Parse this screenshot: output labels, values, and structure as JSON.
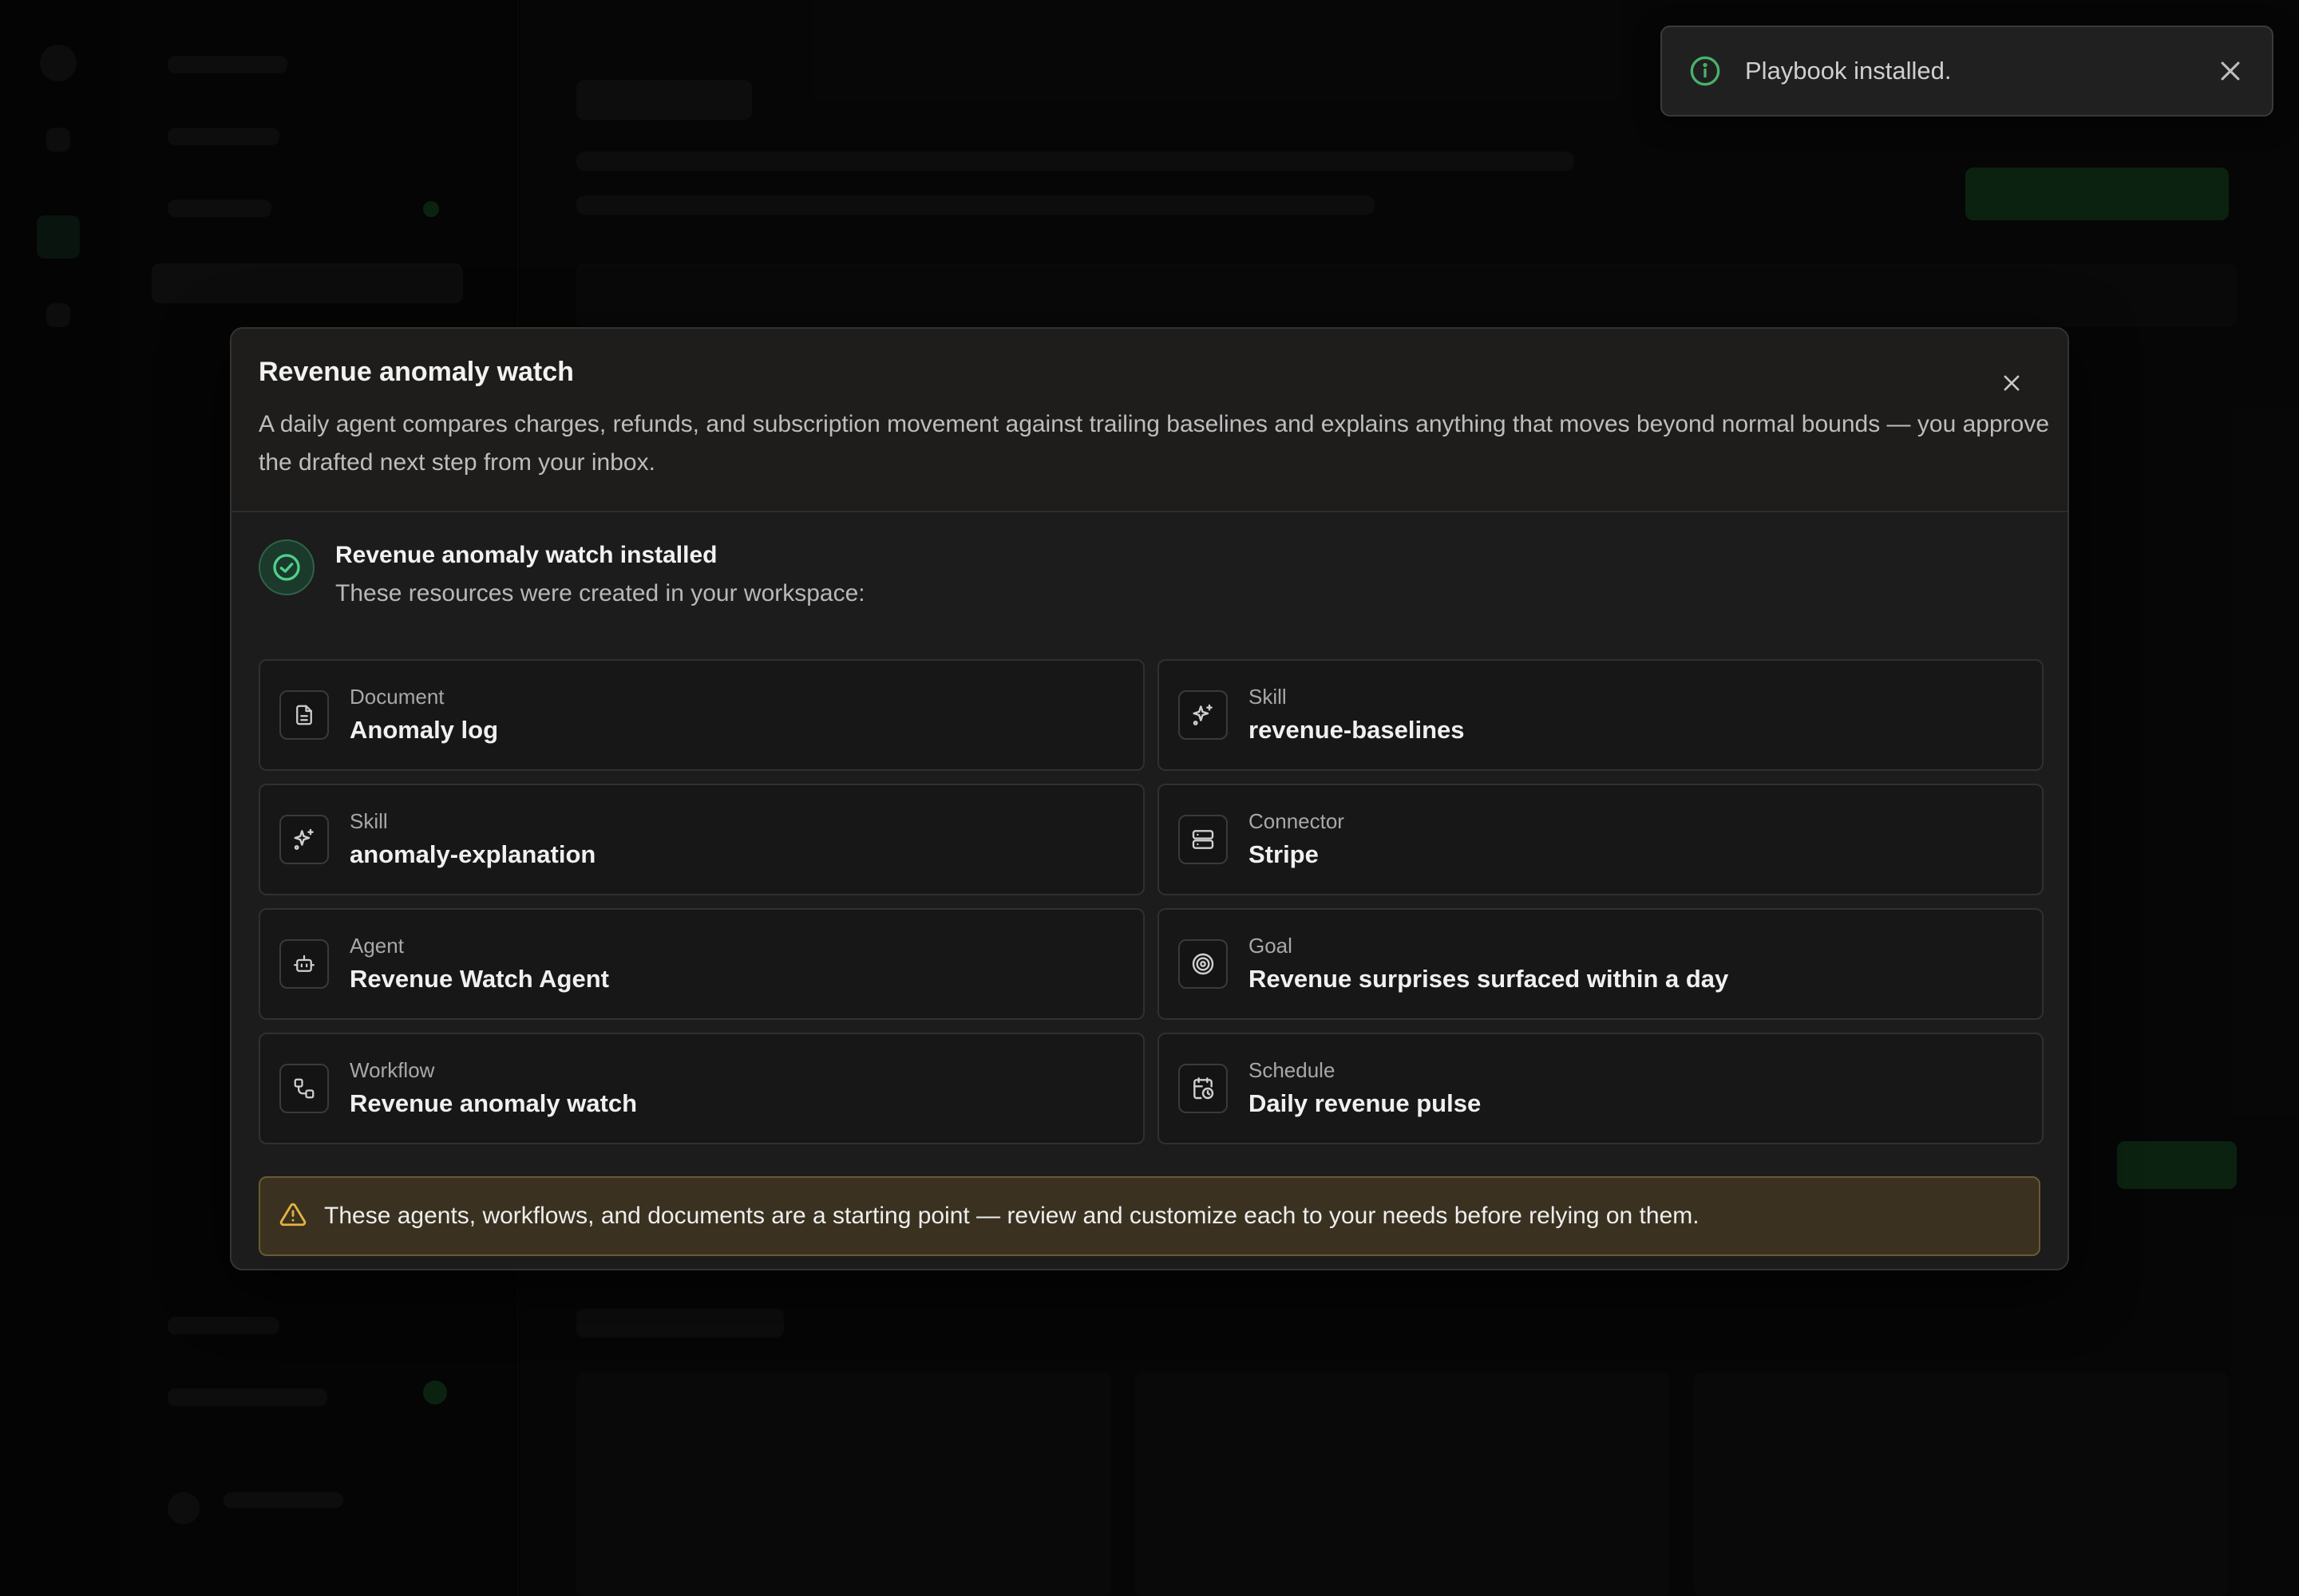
{
  "toast": {
    "message": "Playbook installed.",
    "icon": "info-icon",
    "accent_color": "#4caf6a"
  },
  "modal": {
    "title": "Revenue anomaly watch",
    "description": "A daily agent compares charges, refunds, and subscription movement against trailing baselines and explains anything that moves beyond normal bounds — you approve the drafted next step from your inbox.",
    "installed_title": "Revenue anomaly watch installed",
    "installed_subtitle": "These resources were created in your workspace:",
    "resources": [
      {
        "type": "Document",
        "name": "Anomaly log",
        "icon": "document-icon"
      },
      {
        "type": "Skill",
        "name": "revenue-baselines",
        "icon": "sparkle-icon"
      },
      {
        "type": "Skill",
        "name": "anomaly-explanation",
        "icon": "sparkle-icon"
      },
      {
        "type": "Connector",
        "name": "Stripe",
        "icon": "server-icon"
      },
      {
        "type": "Agent",
        "name": "Revenue Watch Agent",
        "icon": "bot-icon"
      },
      {
        "type": "Goal",
        "name": "Revenue surprises surfaced within a day",
        "icon": "target-icon"
      },
      {
        "type": "Workflow",
        "name": "Revenue anomaly watch",
        "icon": "workflow-icon"
      },
      {
        "type": "Schedule",
        "name": "Daily revenue pulse",
        "icon": "calendar-clock-icon"
      }
    ],
    "warning": "These agents, workflows, and documents are a starting point — review and customize each to your needs before relying on them.",
    "warning_color": "#e3b341",
    "success_color": "#4fd18b"
  }
}
